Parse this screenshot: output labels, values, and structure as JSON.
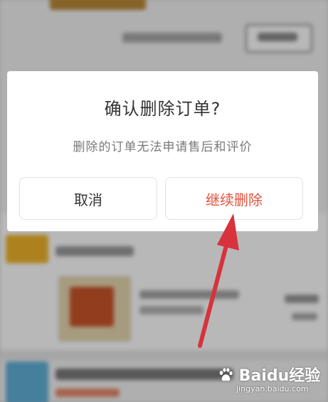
{
  "dialog": {
    "title": "确认删除订单?",
    "message": "删除的订单无法申请售后和评价",
    "cancel_label": "取消",
    "confirm_label": "继续删除"
  },
  "watermark": {
    "brand": "Baidu经验",
    "url": "jingyan.baidu.com"
  },
  "colors": {
    "confirm_text": "#e2523b",
    "cancel_text": "#333333",
    "annotation_arrow": "#d8323c"
  },
  "icons": {
    "annotation": "red-arrow-icon",
    "watermark_logo": "baidu-paw-icon"
  }
}
